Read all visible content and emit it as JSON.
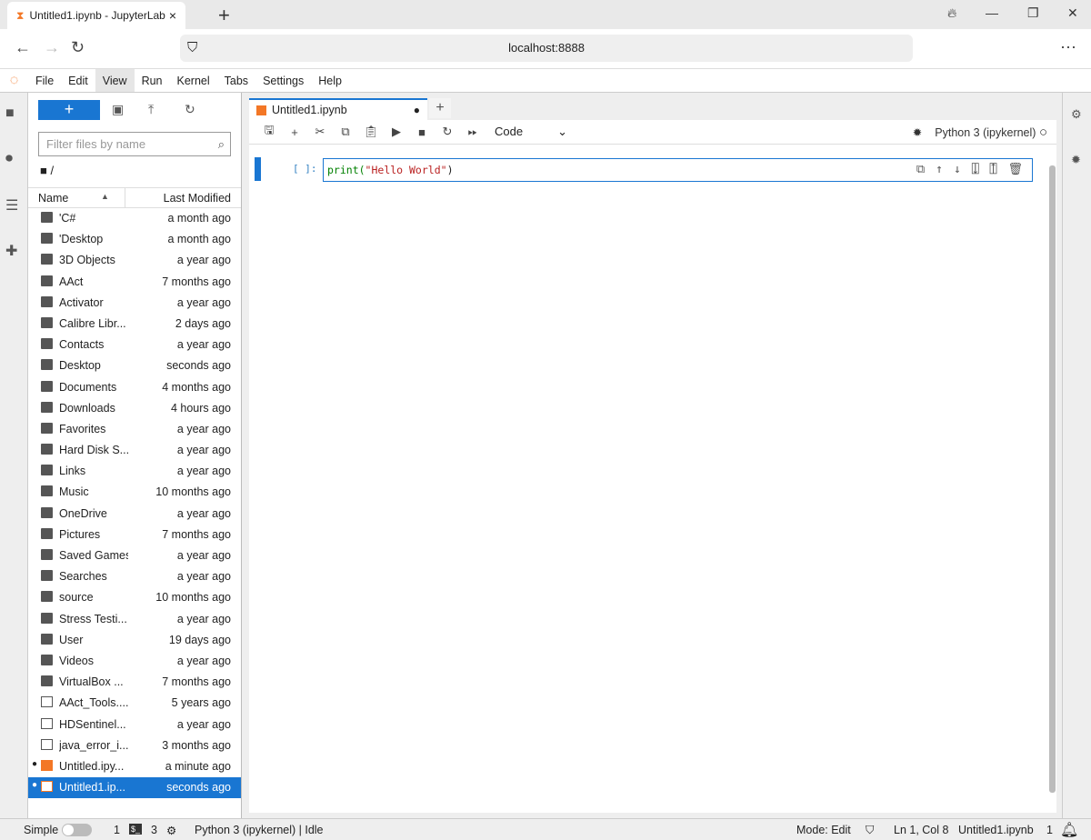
{
  "browser": {
    "tab_title": "Untitled1.ipynb - JupyterLab",
    "url": "localhost:8888"
  },
  "menu": [
    "File",
    "Edit",
    "View",
    "Run",
    "Kernel",
    "Tabs",
    "Settings",
    "Help"
  ],
  "filebrowser": {
    "new_label": "+",
    "filter_placeholder": "Filter files by name",
    "path": "/",
    "col_name": "Name",
    "col_modified": "Last Modified",
    "files": [
      {
        "name": "'C#",
        "modified": "a month ago",
        "type": "folder"
      },
      {
        "name": "'Desktop",
        "modified": "a month ago",
        "type": "folder"
      },
      {
        "name": "3D Objects",
        "modified": "a year ago",
        "type": "folder"
      },
      {
        "name": "AAct",
        "modified": "7 months ago",
        "type": "folder"
      },
      {
        "name": "Activator",
        "modified": "a year ago",
        "type": "folder"
      },
      {
        "name": "Calibre Libr...",
        "modified": "2 days ago",
        "type": "folder"
      },
      {
        "name": "Contacts",
        "modified": "a year ago",
        "type": "folder"
      },
      {
        "name": "Desktop",
        "modified": "seconds ago",
        "type": "folder"
      },
      {
        "name": "Documents",
        "modified": "4 months ago",
        "type": "folder"
      },
      {
        "name": "Downloads",
        "modified": "4 hours ago",
        "type": "folder"
      },
      {
        "name": "Favorites",
        "modified": "a year ago",
        "type": "folder"
      },
      {
        "name": "Hard Disk S...",
        "modified": "a year ago",
        "type": "folder"
      },
      {
        "name": "Links",
        "modified": "a year ago",
        "type": "folder"
      },
      {
        "name": "Music",
        "modified": "10 months ago",
        "type": "folder"
      },
      {
        "name": "OneDrive",
        "modified": "a year ago",
        "type": "folder"
      },
      {
        "name": "Pictures",
        "modified": "7 months ago",
        "type": "folder"
      },
      {
        "name": "Saved Games",
        "modified": "a year ago",
        "type": "folder"
      },
      {
        "name": "Searches",
        "modified": "a year ago",
        "type": "folder"
      },
      {
        "name": "source",
        "modified": "10 months ago",
        "type": "folder"
      },
      {
        "name": "Stress Testi...",
        "modified": "a year ago",
        "type": "folder"
      },
      {
        "name": "User",
        "modified": "19 days ago",
        "type": "folder"
      },
      {
        "name": "Videos",
        "modified": "a year ago",
        "type": "folder"
      },
      {
        "name": "VirtualBox ...",
        "modified": "7 months ago",
        "type": "folder"
      },
      {
        "name": "AAct_Tools....",
        "modified": "5 years ago",
        "type": "file"
      },
      {
        "name": "HDSentinel...",
        "modified": "a year ago",
        "type": "file"
      },
      {
        "name": "java_error_i...",
        "modified": "3 months ago",
        "type": "file"
      },
      {
        "name": "Untitled.ipy...",
        "modified": "a minute ago",
        "type": "notebook",
        "running": true
      },
      {
        "name": "Untitled1.ip...",
        "modified": "seconds ago",
        "type": "notebook",
        "running": true,
        "selected": true
      }
    ]
  },
  "notebook": {
    "tab_label": "Untitled1.ipynb",
    "cell_type": "Code",
    "kernel": "Python 3 (ipykernel)",
    "prompt": "[ ]:",
    "code": {
      "fn": "print(",
      "str": "\"Hello World\"",
      "end": ")"
    }
  },
  "status": {
    "simple": "Simple",
    "terminals": "1",
    "kernels": "3",
    "kernel_status": "Python 3 (ipykernel) | Idle",
    "mode": "Mode: Edit",
    "position": "Ln 1, Col 8",
    "file": "Untitled1.ipynb",
    "notifications": "1"
  },
  "colors": {
    "accent": "#1976d2",
    "notebook_icon": "#f37726"
  }
}
